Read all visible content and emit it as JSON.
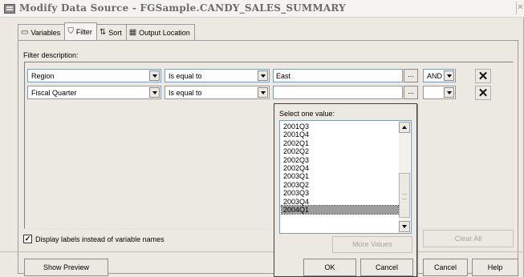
{
  "window": {
    "title": "Modify Data Source - FGSample.CANDY_SALES_SUMMARY"
  },
  "tabs": [
    {
      "label": "Variables",
      "icon": "variables-icon",
      "active": false
    },
    {
      "label": "Filter",
      "icon": "filter-icon",
      "active": true
    },
    {
      "label": "Sort",
      "icon": "sort-icon",
      "active": false
    },
    {
      "label": "Output Location",
      "icon": "output-location-icon",
      "active": false
    }
  ],
  "filter": {
    "description_label": "Filter description:",
    "rows": [
      {
        "variable": "Region",
        "operator": "Is equal to",
        "value": "East",
        "dots": "...",
        "logic": "AND"
      },
      {
        "variable": "Fiscal Quarter",
        "operator": "Is equal to",
        "value": "",
        "dots": "...",
        "logic": ""
      }
    ]
  },
  "popup": {
    "label": "Select one value:",
    "items": [
      "2001Q3",
      "2001Q4",
      "2002Q1",
      "2002Q2",
      "2002Q3",
      "2002Q4",
      "2003Q1",
      "2003Q2",
      "2003Q3",
      "2003Q4",
      "2004Q1"
    ],
    "selected": "2004Q1",
    "more_values": "More Values",
    "ok": "OK",
    "cancel": "Cancel"
  },
  "options": {
    "display_labels": "Display labels instead of variable names",
    "checked": true
  },
  "buttons": {
    "clear_all": "Clear All",
    "show_preview": "Show Preview",
    "cancel": "Cancel",
    "help": "Help"
  }
}
